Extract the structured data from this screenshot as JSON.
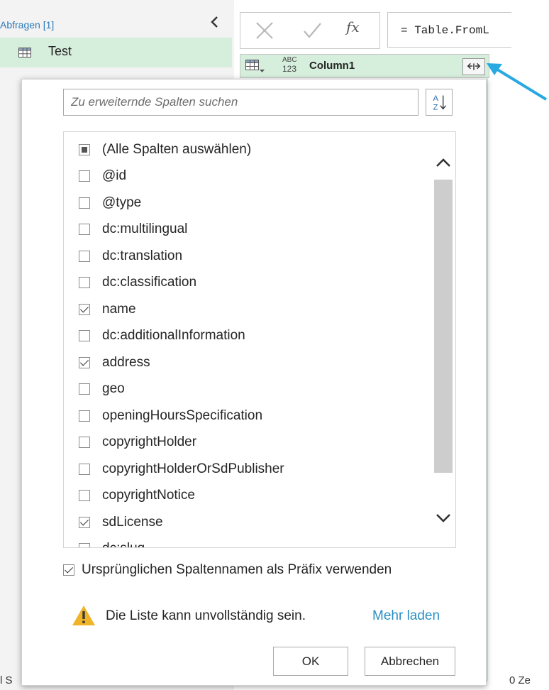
{
  "queries": {
    "header": "Abfragen [1]",
    "items": [
      {
        "label": "Test",
        "icon": "table-icon"
      }
    ]
  },
  "formula_bar": {
    "formula": "= Table.FromL",
    "icons": [
      "cancel-icon",
      "check-icon",
      "fx-icon"
    ]
  },
  "column": {
    "type_top": "ABC",
    "type_bottom": "123",
    "name": "Column1",
    "expand_icon": "expand-icon",
    "header_color": "#d6eedc"
  },
  "popup": {
    "search_placeholder": "Zu erweiternde Spalten suchen",
    "sort_icon": "sort-az-icon",
    "select_all": {
      "label": "(Alle Spalten auswählen)",
      "state": "partial"
    },
    "items": [
      {
        "label": "@id",
        "checked": false
      },
      {
        "label": "@type",
        "checked": false
      },
      {
        "label": "dc:multilingual",
        "checked": false
      },
      {
        "label": "dc:translation",
        "checked": false
      },
      {
        "label": "dc:classification",
        "checked": false
      },
      {
        "label": "name",
        "checked": true
      },
      {
        "label": "dc:additionalInformation",
        "checked": false
      },
      {
        "label": "address",
        "checked": true
      },
      {
        "label": "geo",
        "checked": false
      },
      {
        "label": "openingHoursSpecification",
        "checked": false
      },
      {
        "label": "copyrightHolder",
        "checked": false
      },
      {
        "label": "copyrightHolderOrSdPublisher",
        "checked": false
      },
      {
        "label": "copyrightNotice",
        "checked": false
      },
      {
        "label": "sdLicense",
        "checked": true
      },
      {
        "label": "dc:slug",
        "checked": false
      }
    ],
    "prefix": {
      "label": "Ursprünglichen Spaltennamen als Präfix verwenden",
      "checked": true
    },
    "warning": {
      "text": "Die Liste kann unvollständig sein.",
      "icon": "warning-icon",
      "color": "#f0b429"
    },
    "load_more": "Mehr laden",
    "ok_label": "OK",
    "cancel_label": "Abbrechen"
  },
  "bottom_bar": {
    "left": "l S",
    "right": "0 Ze"
  },
  "colors": {
    "accent": "#2b8fc4",
    "arrow": "#29a9e1",
    "query_selected": "#d6eedc"
  }
}
